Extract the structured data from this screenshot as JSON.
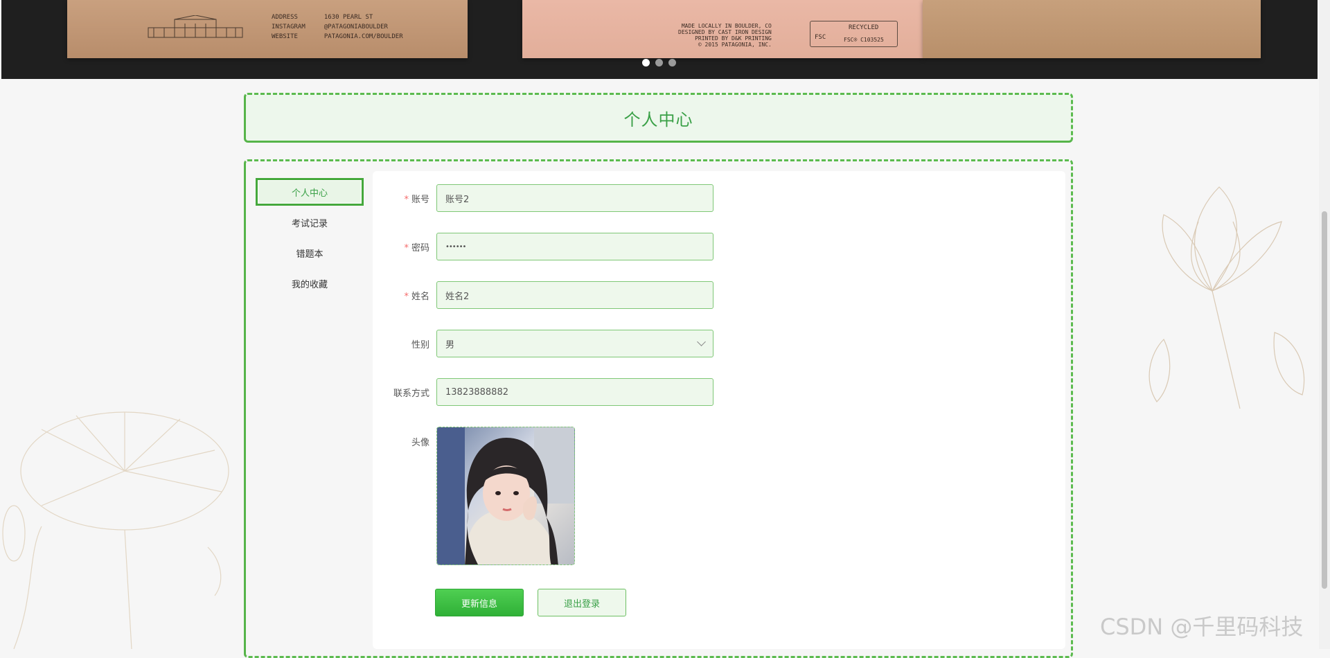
{
  "banner": {
    "card_left_text": "ADDRESS       1630 PEARL ST\nINSTAGRAM     @PATAGONIABOULDER\nWEBSITE       PATAGONIA.COM/BOULDER",
    "card_mid_text": "MADE LOCALLY IN BOULDER, CO\nDESIGNED BY CAST IRON DESIGN\nPRINTED BY D&K PRINTING\n© 2015 PATAGONIA, INC.",
    "recycled_text": "RECYCLED",
    "fsc_label": "FSC",
    "fsc_code": "FSC® C103525",
    "slides": 3,
    "active_slide": 1
  },
  "page_title": "个人中心",
  "sidebar": {
    "items": [
      {
        "label": "个人中心",
        "active": true
      },
      {
        "label": "考试记录",
        "active": false
      },
      {
        "label": "错题本",
        "active": false
      },
      {
        "label": "我的收藏",
        "active": false
      }
    ]
  },
  "form": {
    "account": {
      "label": "账号",
      "value": "账号2",
      "required": true
    },
    "password": {
      "label": "密码",
      "value": "••••••",
      "required": true
    },
    "name": {
      "label": "姓名",
      "value": "姓名2",
      "required": true
    },
    "gender": {
      "label": "性别",
      "value": "男"
    },
    "contact": {
      "label": "联系方式",
      "value": "13823888882"
    },
    "avatar": {
      "label": "头像"
    }
  },
  "buttons": {
    "update": "更新信息",
    "logout": "退出登录"
  },
  "watermark": "CSDN @千里码科技",
  "colors": {
    "accent": "#3aa047",
    "border": "#5cbb4f",
    "input_bg": "#eef8ec"
  }
}
